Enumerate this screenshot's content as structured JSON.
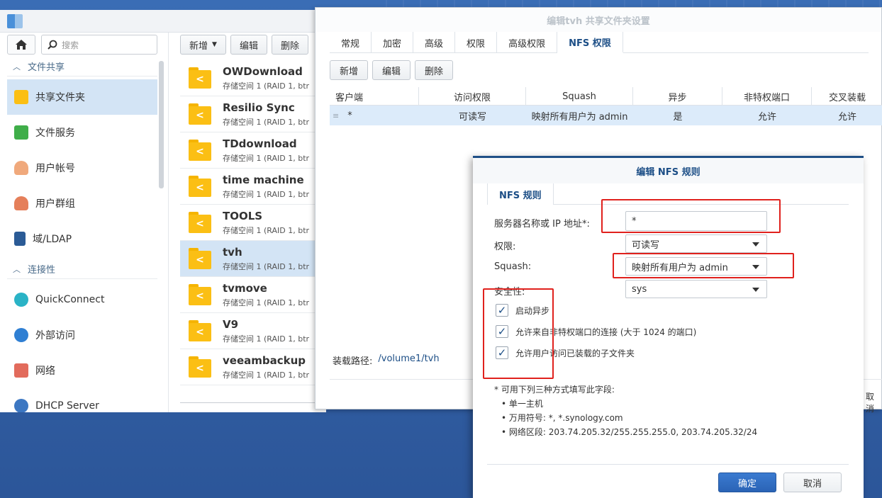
{
  "control_panel": {
    "search_placeholder": "搜索",
    "sections": [
      {
        "label": "文件共享"
      },
      {
        "label": "连接性"
      }
    ],
    "nav_items": [
      {
        "label": "共享文件夹",
        "icon": "shared-folder-icon"
      },
      {
        "label": "文件服务",
        "icon": "file-services-icon"
      },
      {
        "label": "用户帐号",
        "icon": "user-icon"
      },
      {
        "label": "用户群组",
        "icon": "group-icon"
      },
      {
        "label": "域/LDAP",
        "icon": "domain-icon"
      },
      {
        "label": "QuickConnect",
        "icon": "quickconnect-icon"
      },
      {
        "label": "外部访问",
        "icon": "globe-icon"
      },
      {
        "label": "网络",
        "icon": "network-icon"
      },
      {
        "label": "DHCP Server",
        "icon": "dhcp-icon"
      }
    ],
    "toolbar": {
      "new_label": "新增",
      "edit_label": "编辑",
      "delete_label": "删除"
    },
    "folders": [
      {
        "name": "OWDownload",
        "sub": "存储空间 1 (RAID 1, btr"
      },
      {
        "name": "Resilio Sync",
        "sub": "存储空间 1 (RAID 1, btr"
      },
      {
        "name": "TDdownload",
        "sub": "存储空间 1 (RAID 1, btr"
      },
      {
        "name": "time machine",
        "sub": "存储空间 1 (RAID 1, btr"
      },
      {
        "name": "TOOLS",
        "sub": "存储空间 1 (RAID 1, btr"
      },
      {
        "name": "tvh",
        "sub": "存储空间 1 (RAID 1, btr"
      },
      {
        "name": "tvmove",
        "sub": "存储空间 1 (RAID 1, btr"
      },
      {
        "name": "V9",
        "sub": "存储空间 1 (RAID 1, btr"
      },
      {
        "name": "veeambackup",
        "sub": "存储空间 1 (RAID 1, btr"
      }
    ]
  },
  "share_window": {
    "title": "编辑tvh 共享文件夹设置",
    "tabs": [
      "常规",
      "加密",
      "高级",
      "权限",
      "高级权限",
      "NFS 权限"
    ],
    "toolbar": {
      "add_label": "新增",
      "edit_label": "编辑",
      "delete_label": "删除"
    },
    "columns": [
      "客户端",
      "访问权限",
      "Squash",
      "异步",
      "非特权端口",
      "交叉装载"
    ],
    "rows": [
      {
        "client": "*",
        "access": "可读写",
        "squash": "映射所有用户为 admin",
        "async": "是",
        "nonpriv": "允许",
        "crossmnt": "允许"
      }
    ],
    "mount_path_label": "装载路径:",
    "mount_path_value": "/volume1/tvh",
    "cancel_fragment": "取消"
  },
  "nfs_dialog": {
    "title": "编辑 NFS 规则",
    "tab": "NFS 规则",
    "host_label": "服务器名称或 IP 地址*:",
    "host_value": "*",
    "privilege_label": "权限:",
    "privilege_value": "可读写",
    "squash_label": "Squash:",
    "squash_value": "映射所有用户为 admin",
    "security_label": "安全性:",
    "security_value": "sys",
    "checkboxes": [
      {
        "label": "启动异步",
        "checked": true
      },
      {
        "label": "允许来自非特权端口的连接 (大于 1024 的端口)",
        "checked": true
      },
      {
        "label": "允许用户访问已装载的子文件夹",
        "checked": true
      }
    ],
    "note_header": "* 可用下列三种方式填写此字段:",
    "notes": [
      "• 单一主机",
      "• 万用符号:   *, *.synology.com",
      "• 网络区段:   203.74.205.32/255.255.255.0, 203.74.205.32/24"
    ],
    "ok_label": "确定",
    "cancel_label": "取消"
  },
  "colors": {
    "accent": "#1c4e86",
    "highlight": "#e0211d",
    "folder": "#fbbf14",
    "selected": "#d3e4f5"
  }
}
